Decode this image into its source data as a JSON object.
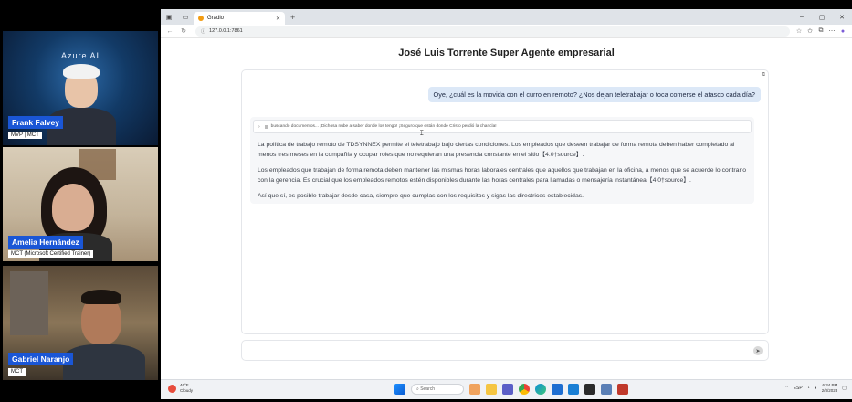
{
  "participants": [
    {
      "name": "Frank Falvey",
      "role": "MVP | MCT",
      "stage_text": "Azure AI"
    },
    {
      "name": "Amelia Hernández",
      "role": "MCT (Microsoft Certified Trainer)"
    },
    {
      "name": "Gabriel Naranjo",
      "role": "MCT"
    }
  ],
  "browser": {
    "tab_title": "Gradio",
    "url": "127.0.0.1:7861",
    "window_controls": [
      "–",
      "▢",
      "✕"
    ]
  },
  "page": {
    "title": "José Luis Torrente Super Agente empresarial",
    "user_message": "Oye, ¿cuál es la movida con el curro en remoto? ¿Nos dejan teletrabajar o toca comerse el atasco cada día?",
    "status_line": "buscando documentos... ¡Dichosa nube a saber donde los tengo! ¡Seguro que están donde Cristo perdió la chancla!",
    "bot_paragraphs": [
      "La política de trabajo remoto de TDSYNNEX permite el teletrabajo bajo ciertas condiciones. Los empleados que deseen trabajar de forma remota deben haber completado al menos tres meses en la compañía y ocupar roles que no requieran una presencia constante en el sitio【4.0†source】.",
      "Los empleados que trabajan de forma remota deben mantener las mismas horas laborales centrales que aquellos que trabajan en la oficina, a menos que se acuerde lo contrario con la gerencia. Es crucial que los empleados remotos estén disponibles durante las horas centrales para llamadas o mensajería instantánea【4.0†source】.",
      "Así que sí, es posible trabajar desde casa, siempre que cumplas con los requisitos y sigas las directrices establecidas."
    ],
    "input_placeholder": ""
  },
  "taskbar": {
    "weather_temp": "46°F",
    "weather_desc": "Cloudy",
    "search_label": "Search",
    "lang": "ESP",
    "time": "6:34 PM",
    "date": "2/8/2023"
  },
  "colors": {
    "name_badge": "#1a56d6",
    "user_bubble": "#dce8f7",
    "bot_bubble": "#f6f7f9"
  }
}
